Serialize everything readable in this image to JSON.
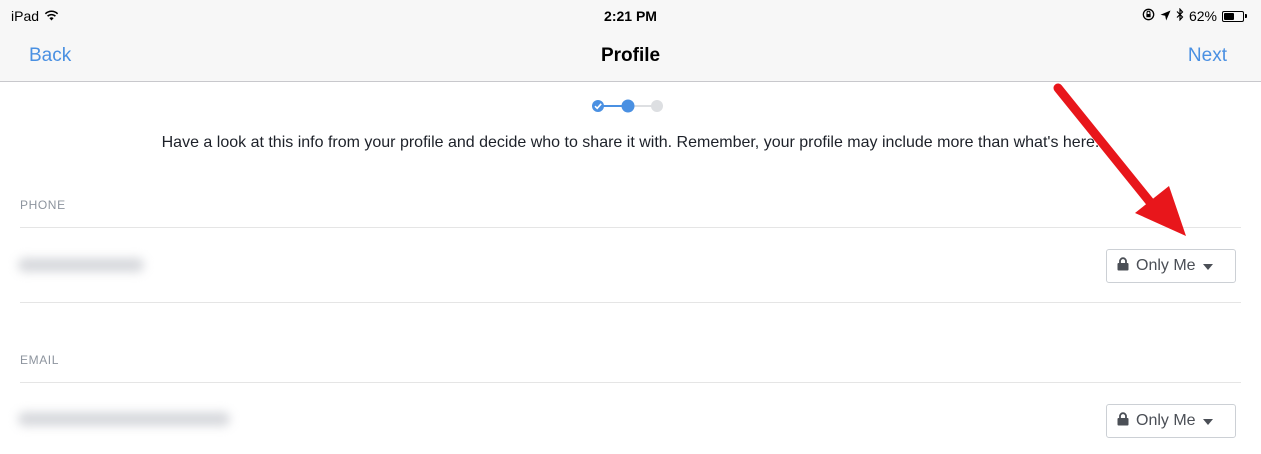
{
  "status_bar": {
    "device": "iPad",
    "time": "2:21 PM",
    "battery": "62%",
    "battery_level": 0.62,
    "icons": [
      "wifi-icon",
      "orientation-lock-icon",
      "location-icon",
      "bluetooth-icon",
      "battery-icon"
    ]
  },
  "nav": {
    "back_label": "Back",
    "title": "Profile",
    "next_label": "Next"
  },
  "stepper": {
    "total_steps": 3,
    "current_step": 2,
    "completed_steps": 1,
    "active_color": "#4a90e2",
    "inactive_color": "#dddfe2"
  },
  "intro_text": "Have a look at this info from your profile and decide who to share it with. Remember, your profile may include more than what's here.",
  "sections": [
    {
      "label": "PHONE",
      "value_blurred": true,
      "privacy": "Only Me"
    },
    {
      "label": "EMAIL",
      "value_blurred": true,
      "privacy": "Only Me"
    }
  ],
  "colors": {
    "accent": "#4a90e2",
    "annotation_arrow": "#e8161b",
    "section_label": "#8d949e",
    "bar_background": "#f7f7f7"
  }
}
